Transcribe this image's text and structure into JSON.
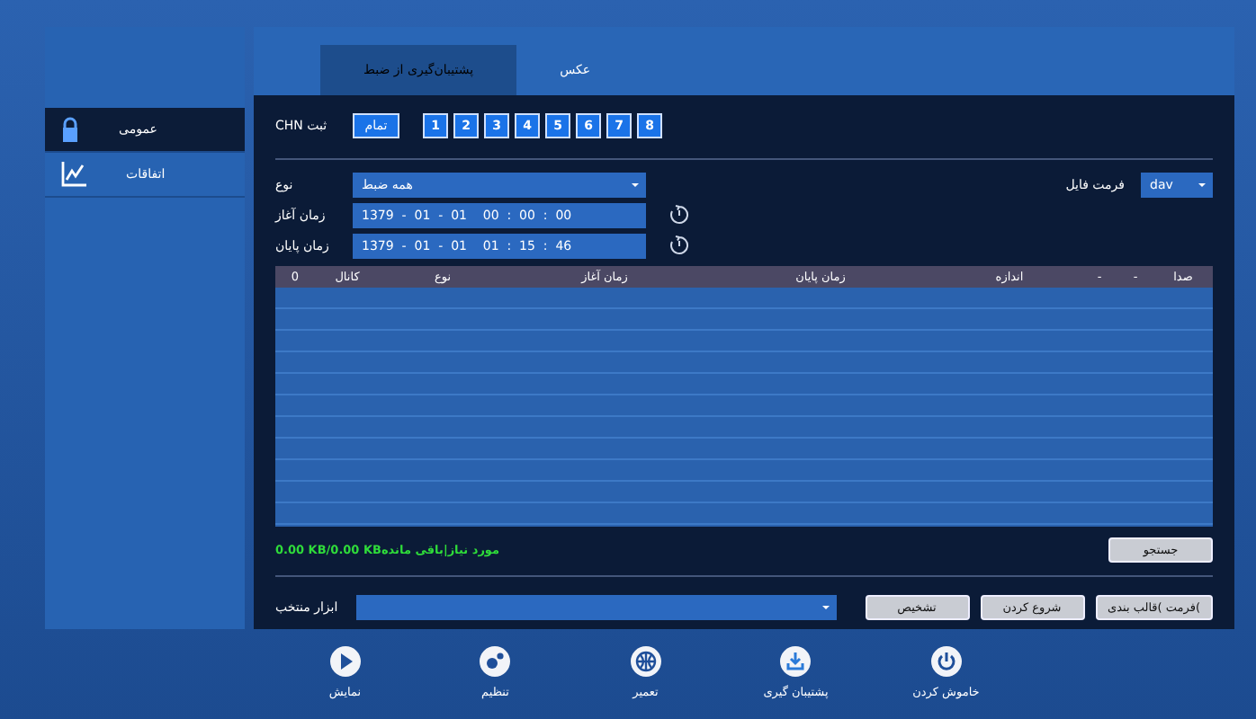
{
  "sidebar": {
    "items": [
      {
        "label": "عمومی",
        "selected": true
      },
      {
        "label": "اتفاقات",
        "selected": false
      }
    ]
  },
  "tabs": [
    {
      "label": "عکس",
      "selected": false
    },
    {
      "label": "پشتیبان‌گیری از ضبط",
      "selected": true
    }
  ],
  "channels": {
    "label": "CHN ثبت",
    "all_button": "تمام",
    "buttons": [
      {
        "label": "8",
        "selected": true
      },
      {
        "label": "7",
        "selected": true
      },
      {
        "label": "6",
        "selected": true
      },
      {
        "label": "5",
        "selected": true
      },
      {
        "label": "4",
        "selected": true
      },
      {
        "label": "3",
        "selected": true
      },
      {
        "label": "2",
        "selected": true
      },
      {
        "label": "1",
        "selected": true
      }
    ]
  },
  "type": {
    "label": "نوع",
    "value": "همه ضبط"
  },
  "file_format": {
    "label": "فرمت فایل",
    "value": "dav"
  },
  "start_time": {
    "label": "زمان آغاز",
    "value": "1379  -  01  -  01    00  :  00  :  00"
  },
  "end_time": {
    "label": "زمان پایان",
    "value": "1379  -  01  -  01    01  :  15  :  46"
  },
  "table": {
    "columns": [
      "صدا",
      "-",
      "-",
      "اندازه",
      "زمان پایان",
      "زمان آغاز",
      "نوع",
      "کانال",
      "0"
    ]
  },
  "status": "0.00 KB/0.00 KBمورد نیاز|باقی مانده",
  "search_button": "جستجو",
  "tool": {
    "label": "ابزار منتخب",
    "buttons": [
      "فرمت )قالب بندی(",
      "شروع کردن",
      "تشخیص"
    ]
  },
  "dock": [
    {
      "label": "خاموش کردن"
    },
    {
      "label": "پشتیبان گیری"
    },
    {
      "label": "تعمیر"
    },
    {
      "label": "تنظیم"
    },
    {
      "label": "نمایش"
    }
  ]
}
